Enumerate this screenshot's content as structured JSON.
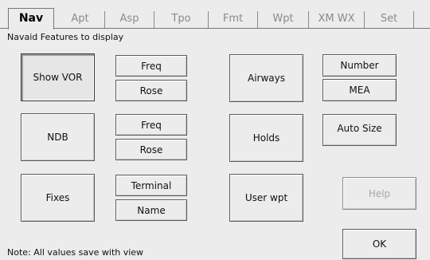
{
  "tabs": [
    {
      "label": "Nav",
      "active": true
    },
    {
      "label": "Apt",
      "active": false
    },
    {
      "label": "Asp",
      "active": false
    },
    {
      "label": "Tpo",
      "active": false
    },
    {
      "label": "Fmt",
      "active": false
    },
    {
      "label": "Wpt",
      "active": false
    },
    {
      "label": "XM WX",
      "active": false
    },
    {
      "label": "Set",
      "active": false
    }
  ],
  "section_label": "Navaid Features to display",
  "buttons": {
    "show_vor": "Show VOR",
    "vor_freq": "Freq",
    "vor_rose": "Rose",
    "ndb": "NDB",
    "ndb_freq": "Freq",
    "ndb_rose": "Rose",
    "fixes": "Fixes",
    "fix_terminal": "Terminal",
    "fix_name": "Name",
    "airways": "Airways",
    "airway_number": "Number",
    "airway_mea": "MEA",
    "holds": "Holds",
    "auto_size": "Auto Size",
    "user_wpt": "User wpt",
    "help": "Help",
    "ok": "OK"
  },
  "note": "Note: All values save with view"
}
